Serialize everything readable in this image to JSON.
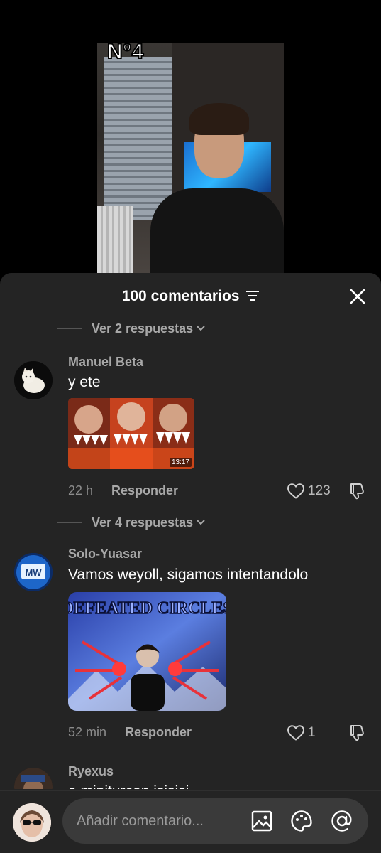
{
  "video": {
    "overlay_tag": "Nº4"
  },
  "sheet": {
    "title": "100 comentarios",
    "filter_icon": "sort-lines-icon",
    "close_icon": "close-icon"
  },
  "threads": [
    {
      "replies_label": "Ver 2 respuestas",
      "user": "Manuel Beta",
      "text": "y ete",
      "media": {
        "kind": "video-thumbnail",
        "duration": "13:17"
      },
      "time": "22 h",
      "reply_label": "Responder",
      "likes": "123"
    },
    {
      "replies_label": "Ver 4 respuestas",
      "user": "Solo-Yuasar",
      "text": "Vamos weyoll, sigamos intentandolo",
      "media": {
        "kind": "image",
        "caption_text": "DEFEATED CIRCLES"
      },
      "time": "52 min",
      "reply_label": "Responder",
      "likes": "1"
    },
    {
      "user": "Ryexus",
      "text": "a miniturcon isisisi"
    }
  ],
  "composer": {
    "placeholder": "Añadir comentario...",
    "icons": [
      "image-icon",
      "emoji-icon",
      "mention-icon"
    ]
  },
  "colors": {
    "sheet_bg": "#242424",
    "input_bg": "#3a3a3a",
    "muted_text": "#a8a8a8"
  }
}
